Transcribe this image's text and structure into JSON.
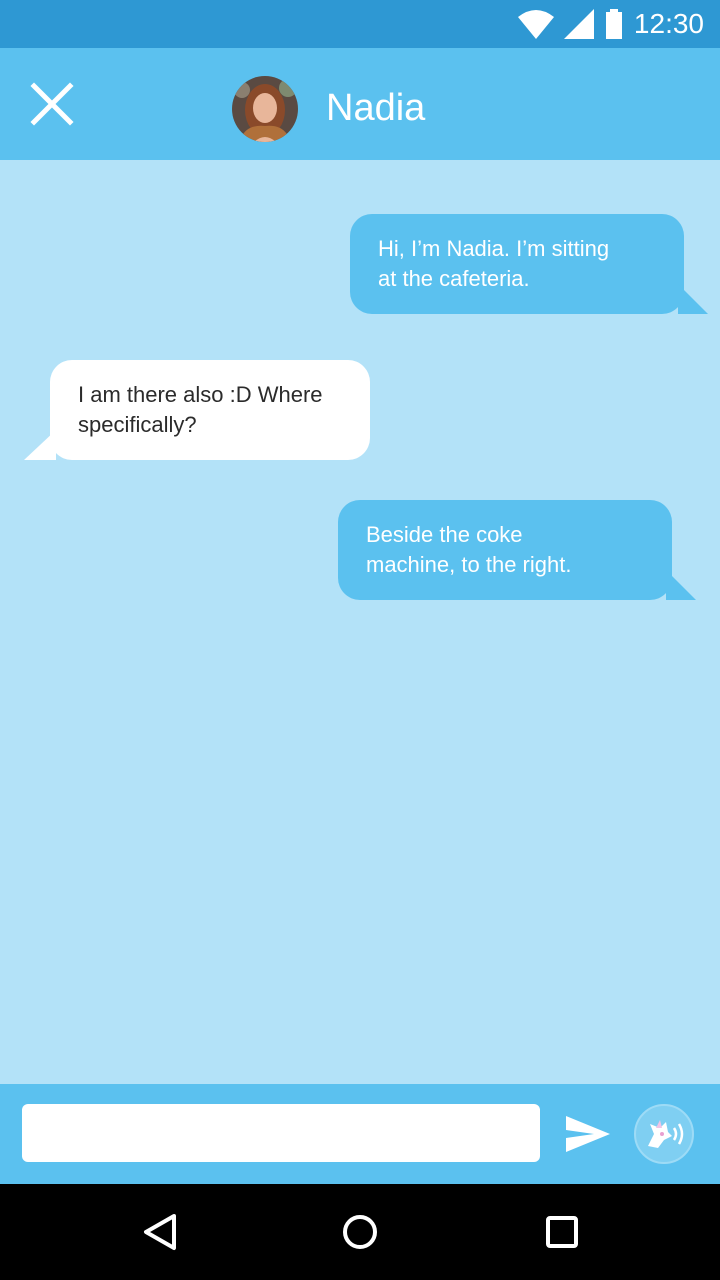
{
  "status_bar": {
    "time": "12:30",
    "icons": [
      "wifi-icon",
      "signal-icon",
      "battery-icon"
    ]
  },
  "header": {
    "close_icon": "close-icon",
    "contact_name": "Nadia",
    "avatar": "avatar-photo"
  },
  "messages": [
    {
      "direction": "outgoing",
      "line1": "Hi, I’m Nadia. I’m sitting",
      "line2": "at the cafeteria."
    },
    {
      "direction": "incoming",
      "line1": "I am there also :D  Where",
      "line2": "specifically?"
    },
    {
      "direction": "outgoing",
      "line1": "Beside the coke",
      "line2": "machine, to the right."
    }
  ],
  "composer": {
    "input_value": "",
    "input_placeholder": "",
    "send_icon": "send-icon",
    "voice_icon": "voice-assistant-icon"
  },
  "nav_bar": {
    "icons": [
      "back-icon",
      "home-icon",
      "recents-icon"
    ]
  },
  "colors": {
    "status_bar": "#2e98d3",
    "header": "#5bc1ef",
    "chat_background": "#b3e2f8",
    "outgoing_bubble": "#5bc1ef",
    "incoming_bubble": "#ffffff"
  }
}
